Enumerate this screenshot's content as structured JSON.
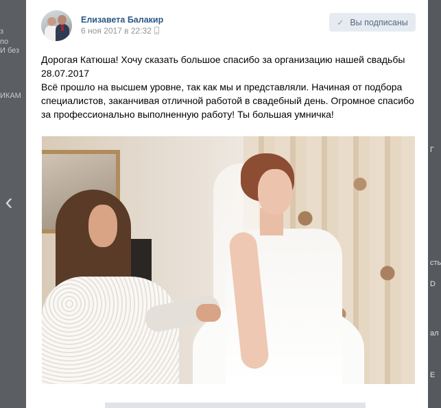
{
  "background_page": {
    "left_fragments": [
      "з",
      "по",
      "И без",
      "ИКАМ"
    ],
    "right_fragments": [
      "Г",
      "сты",
      "D",
      "ал",
      "Е"
    ]
  },
  "post": {
    "author": "Елизавета Балакир",
    "date": "6 ноя 2017 в 22:32",
    "subscribe_label": "Вы подписаны",
    "text_lines": [
      "Дорогая Катюша! Хочу сказать большое спасибо за организацию нашей свадьбы 28.07.2017",
      "Всё прошло на высшем уровне, так как мы и представляли. Начиная от подбора специалистов, заканчивая отличной работой в свадебный день. Огромное спасибо за профессионально выполненную работу! Ты большая умничка!"
    ]
  },
  "icons": {
    "prev": "chevron-left-icon",
    "subscribed": "check-icon",
    "device": "phone-icon"
  },
  "colors": {
    "author_link": "#2a5885",
    "button_bg": "#e5ebf1",
    "button_text": "#55677d",
    "date": "#939393"
  }
}
